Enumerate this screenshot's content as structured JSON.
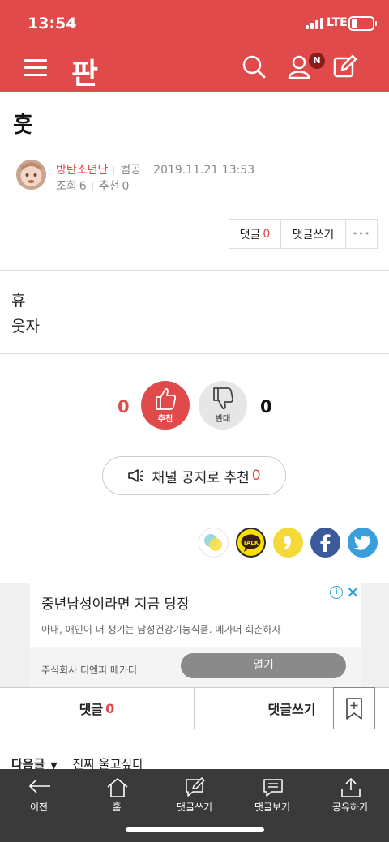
{
  "status": {
    "time": "13:54",
    "network": "LTE"
  },
  "header": {
    "logo": "판",
    "notification_badge": "N"
  },
  "post": {
    "title": "훗",
    "author": "방탄소년단",
    "category": "컴공",
    "datetime": "2019.11.21 13:53",
    "views_label": "조회",
    "views": "6",
    "recommend_label": "추천",
    "recommend": "0",
    "body_lines": [
      "휴",
      "웃자"
    ]
  },
  "actions": {
    "comment_label": "댓글",
    "comment_count": "0",
    "write_comment": "댓글쓰기",
    "more": "•••"
  },
  "votes": {
    "up_count": "0",
    "up_label": "추천",
    "down_label": "반대",
    "down_count": "0"
  },
  "notice": {
    "label": "채널 공지로 추천",
    "count": "0"
  },
  "share": {
    "icons": [
      "kakaostory-icon",
      "kakaotalk-icon",
      "kakao-chat-icon",
      "facebook-icon",
      "twitter-icon"
    ],
    "talk_text": "TALK"
  },
  "ad": {
    "title": "중년남성이라면 지금 당장",
    "description": "아내, 애인이 더 챙기는 남성건강기능식품. 메가더 회춘하자",
    "company": "주식회사 티엔피 메가더",
    "open_label": "열기"
  },
  "comment_bar": {
    "comment_label": "댓글",
    "comment_count": "0",
    "write_label": "댓글쓰기"
  },
  "next_post": {
    "label": "다음글",
    "title": "진짜 울고싶다"
  },
  "tabbar": {
    "items": [
      {
        "label": "이전",
        "icon": "back-arrow-icon"
      },
      {
        "label": "홈",
        "icon": "home-icon"
      },
      {
        "label": "댓글쓰기",
        "icon": "write-comment-icon"
      },
      {
        "label": "댓글보기",
        "icon": "view-comments-icon"
      },
      {
        "label": "공유하기",
        "icon": "share-icon"
      }
    ]
  },
  "colors": {
    "brand": "#e04a4a",
    "vote_down": "#e6e6e6",
    "tabbar": "#3a3a3a"
  }
}
